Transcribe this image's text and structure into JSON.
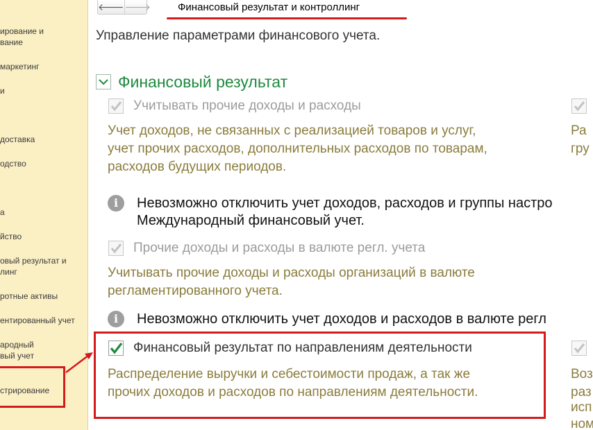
{
  "sidebar": {
    "items": [
      "ирование и",
      "вание",
      "маркетинг",
      "и",
      "доставка",
      "одство",
      "а",
      "йство",
      "овый результат и",
      "линг",
      "ротные активы",
      "ентированный учет",
      "ародный",
      "вый учет",
      "стрирование"
    ]
  },
  "header": {
    "back_icon": "arrow-left-icon",
    "forward_icon": "arrow-right-icon",
    "back_glyph": "🡐",
    "forward_glyph": "🡒",
    "title": "Финансовый результат и контроллинг"
  },
  "subtitle": "Управление параметрами финансового учета.",
  "section": {
    "title": "Финансовый результат",
    "expanded": true
  },
  "options": [
    {
      "label": "Учитывать прочие доходы и расходы",
      "checked": true,
      "enabled": false,
      "description": "Учет доходов, не связанных с реализацией товаров и услуг,\nучет прочих расходов, дополнительных расходов по товарам,\nрасходов будущих периодов.",
      "info": "Невозможно отключить учет доходов, расходов и группы настро\nМеждународный финансовый учет."
    },
    {
      "label": "Прочие доходы и расходы в валюте регл. учета",
      "checked": true,
      "enabled": false,
      "description": "Учитывать прочие доходы и расходы организаций в валюте\nрегламентированного учета.",
      "info": "Невозможно отключить учет доходов и расходов в валюте регл"
    },
    {
      "label": "Финансовый результат по направлениям деятельности",
      "checked": true,
      "enabled": true,
      "description": "Распределение выручки и себестоимости продаж, а так же\nпрочих доходов и расходов по направлениям деятельности."
    }
  ],
  "right_column": {
    "top": [
      "Ра",
      "гру"
    ],
    "bottom": [
      "Воз",
      "раз",
      "исп",
      "ном"
    ]
  },
  "colors": {
    "sidebar_bg": "#fbf0c4",
    "section_title": "#1e8a3e",
    "description": "#8a7c3c",
    "annotation": "#d21b1b",
    "check_mark": "#1e8a3e"
  }
}
